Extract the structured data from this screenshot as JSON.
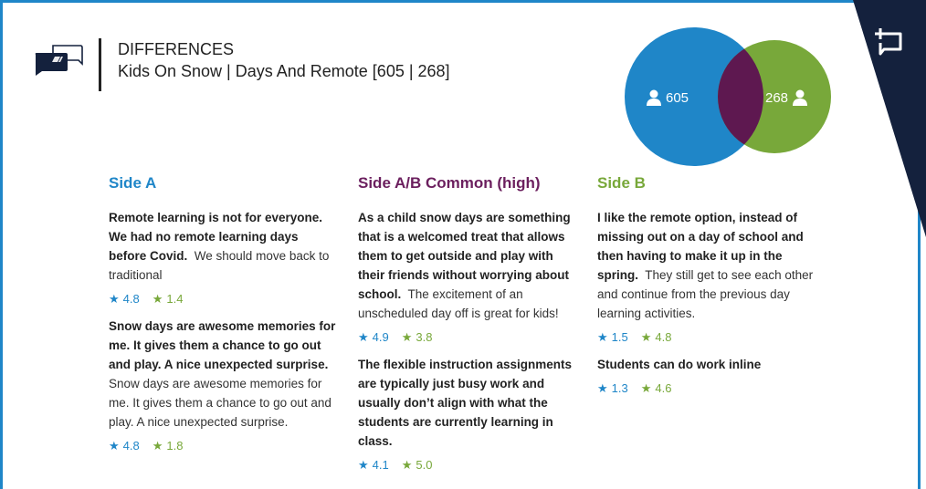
{
  "header": {
    "title": "DIFFERENCES",
    "subtitle": "Kids On Snow | Days And Remote [605 | 268]"
  },
  "venn": {
    "a_count": "605",
    "b_count": "268",
    "colors": {
      "a": "#1f86c8",
      "b": "#78a83a",
      "overlap": "#5e1850"
    }
  },
  "columns": [
    {
      "heading": "Side A",
      "items": [
        {
          "bold": "Remote learning is not for everyone. We had no remote learning days before Covid.",
          "normal": "We should move back to traditional",
          "rating_a": "4.8",
          "rating_b": "1.4"
        },
        {
          "bold": "Snow days are awesome memories for me. It gives them a chance to go out and play. A nice unexpected surprise.",
          "normal": "Snow days are awesome memories for me. It gives them a chance to go out and play. A nice unexpected surprise.",
          "rating_a": "4.8",
          "rating_b": "1.8"
        }
      ]
    },
    {
      "heading": "Side A/B Common (high)",
      "items": [
        {
          "bold": "As a child snow days are something that is a welcomed treat that allows them to get outside and play with their friends without worrying about school.",
          "normal": "The excitement of an unscheduled day off is great for kids!",
          "rating_a": "4.9",
          "rating_b": "3.8"
        },
        {
          "bold": "The flexible instruction assignments are typically just busy work and usually don’t align with what the students are currently learning in class.",
          "normal": "",
          "rating_a": "4.1",
          "rating_b": "5.0"
        }
      ]
    },
    {
      "heading": "Side B",
      "items": [
        {
          "bold": "I like the remote option, instead of missing out on a day of school and then having to make it up in the spring.",
          "normal": "They still get to see each other and continue from the previous day learning activities.",
          "rating_a": "1.5",
          "rating_b": "4.8"
        },
        {
          "bold": "Students can do work inline",
          "normal": "",
          "rating_a": "1.3",
          "rating_b": "4.6"
        }
      ]
    }
  ]
}
